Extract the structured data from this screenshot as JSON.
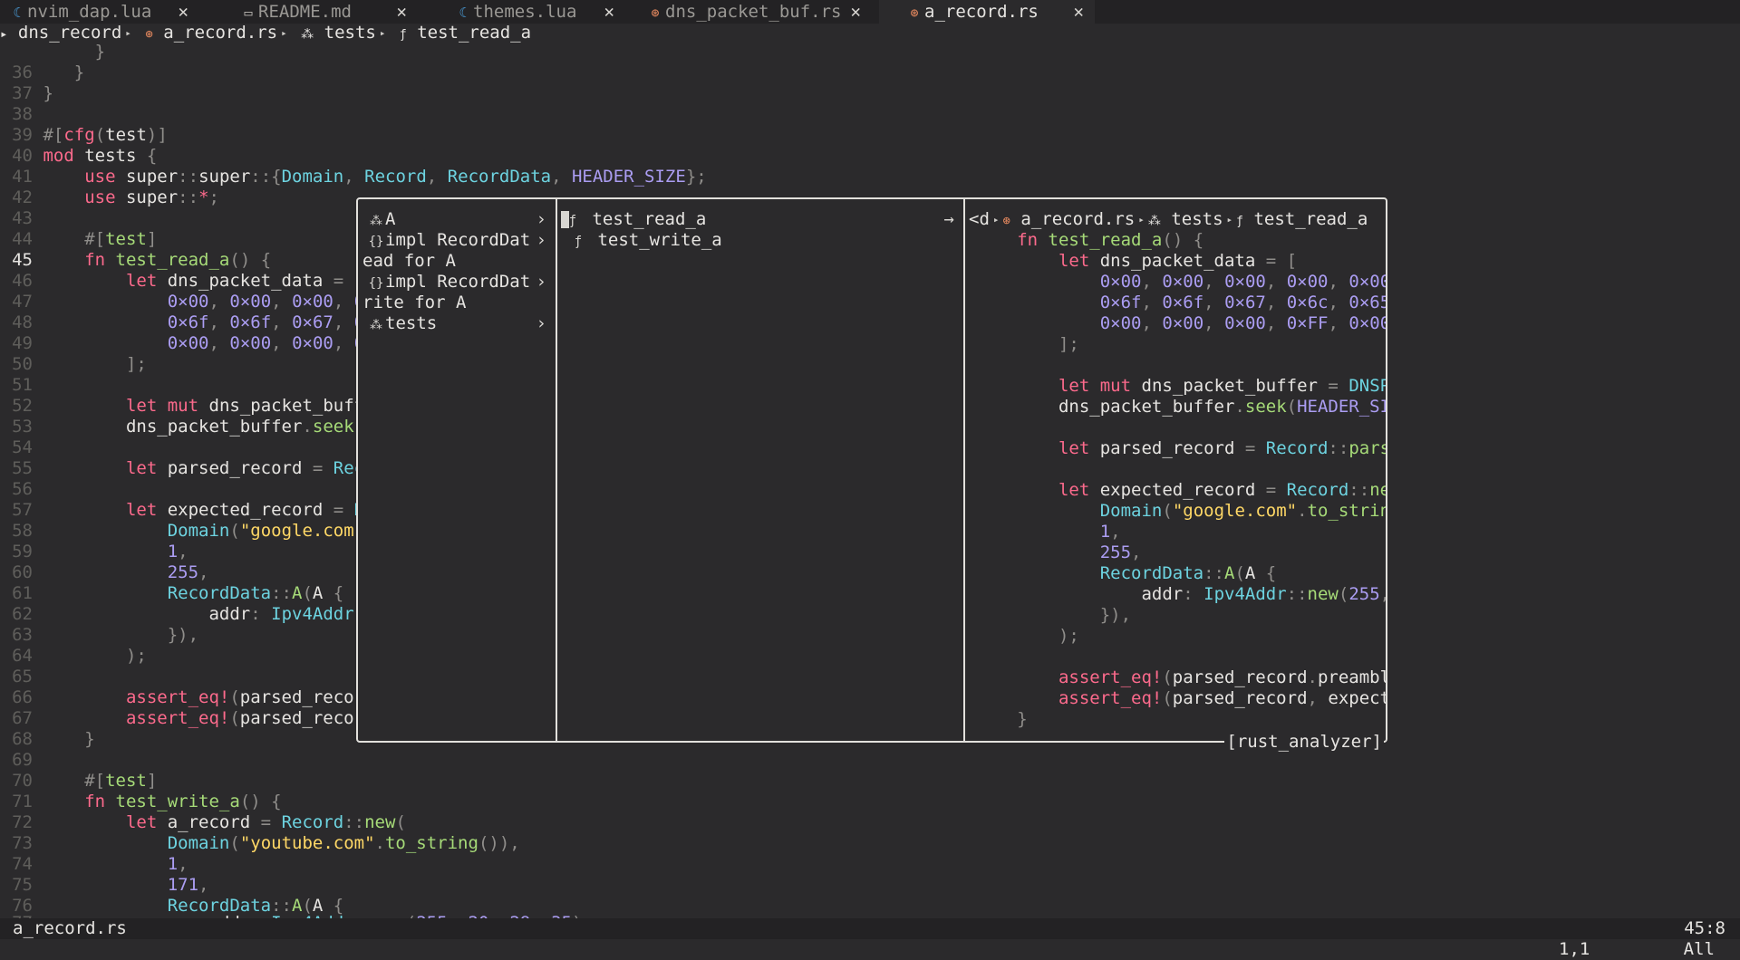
{
  "tabs": [
    {
      "icon": "lua-icon",
      "label": "nvim_dap.lua",
      "active": false
    },
    {
      "icon": "markdown-icon",
      "label": "README.md",
      "active": false
    },
    {
      "icon": "lua-icon",
      "label": "themes.lua",
      "active": false
    },
    {
      "icon": "rust-icon",
      "label": "dns_packet_buf.rs",
      "active": false
    },
    {
      "icon": "rust-icon",
      "label": "a_record.rs",
      "active": true
    }
  ],
  "close_glyph": "✕",
  "winbar": {
    "folder": "dns_record",
    "file": "a_record.rs",
    "module": "tests",
    "function": "test_read_a"
  },
  "popup": {
    "column1": [
      {
        "icon": "module-icon",
        "label": "A",
        "arrow": "›"
      },
      {
        "icon": "braces-icon",
        "label": "impl RecordDat",
        "arrow": "›"
      },
      {
        "icon": "",
        "label": "ead for A",
        "arrow": ""
      },
      {
        "icon": "braces-icon",
        "label": "impl RecordDat",
        "arrow": "›"
      },
      {
        "icon": "",
        "label": "rite for A",
        "arrow": ""
      },
      {
        "icon": "module-icon",
        "label": "tests",
        "arrow": "›"
      }
    ],
    "column2": [
      {
        "icon": "function-icon",
        "label": "test_read_a",
        "arrow": "→"
      },
      {
        "icon": "function-icon",
        "label": "test_write_a",
        "arrow": ""
      }
    ],
    "preview_breadcrumb": {
      "prefix": "<d",
      "file": "a_record.rs",
      "module": "tests",
      "function": "test_read_a"
    },
    "footer": "[rust_analyzer]"
  },
  "status": {
    "filename": "a_record.rs",
    "position": "45:8"
  },
  "cmdline": {
    "ruler": "1,1",
    "scroll": "All"
  }
}
